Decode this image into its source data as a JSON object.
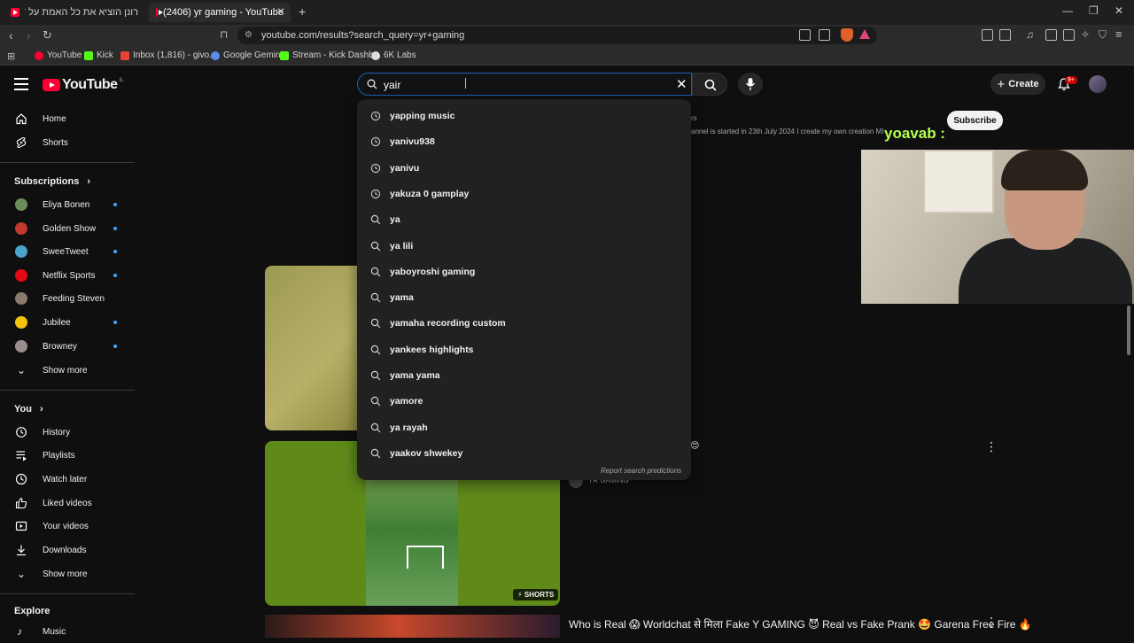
{
  "browser": {
    "tabs": [
      {
        "label": "רונן הוציא את כל האמת על דה כהן...",
        "active": false
      },
      {
        "label": "(2406) yr gaming - YouTube",
        "active": true
      }
    ],
    "url": "youtube.com/results?search_query=yr+gaming",
    "bookmarks": [
      "YouTube",
      "Kick",
      "Inbox (1,816) - givo...",
      "Google Gemini",
      "Stream - Kick Dashb...",
      "6K Labs"
    ]
  },
  "masthead": {
    "logo": "YouTube",
    "country_code": "IL",
    "search_value": "yair",
    "create_label": "Create",
    "notification_badge": "9+"
  },
  "sidebar": {
    "home": "Home",
    "shorts": "Shorts",
    "subscriptions_header": "Subscriptions",
    "subscriptions": [
      {
        "name": "Eliya Bonen",
        "color": "#6a8f5a"
      },
      {
        "name": "Golden Show",
        "color": "#c0392b"
      },
      {
        "name": "SweeTweet",
        "color": "#4aa3c8"
      },
      {
        "name": "Netflix Sports",
        "color": "#e50914"
      },
      {
        "name": "Feeding Steven",
        "color": "#8a7a6a"
      },
      {
        "name": "Jubilee",
        "color": "#f4c20d"
      },
      {
        "name": "Browney",
        "color": "#9a8f8f"
      }
    ],
    "show_more": "Show more",
    "you_header": "You",
    "you_items": [
      "History",
      "Playlists",
      "Watch later",
      "Liked videos",
      "Your videos",
      "Downloads"
    ],
    "show_more_2": "Show more",
    "explore_header": "Explore",
    "explore_items": [
      "Music"
    ]
  },
  "suggestions": [
    {
      "text": "yapping music",
      "type": "history"
    },
    {
      "text": "yanivu938",
      "type": "history"
    },
    {
      "text": "yanivu",
      "type": "history"
    },
    {
      "text": "yakuza 0 gamplay",
      "type": "history"
    },
    {
      "text": "ya",
      "type": "search"
    },
    {
      "text": "ya lili",
      "type": "search"
    },
    {
      "text": "yaboyroshi gaming",
      "type": "search"
    },
    {
      "text": "yama",
      "type": "search"
    },
    {
      "text": "yamaha recording custom",
      "type": "search"
    },
    {
      "text": "yankees highlights",
      "type": "search"
    },
    {
      "text": "yama yama",
      "type": "search"
    },
    {
      "text": "yamore",
      "type": "search"
    },
    {
      "text": "ya rayah",
      "type": "search"
    },
    {
      "text": "yaakov shwekey",
      "type": "search"
    }
  ],
  "report_predictions": "Report search predictions",
  "results": {
    "channel_desc_fragment": "annel is started in 23th July 2024 I create my own creation MI",
    "subscribers_fragment": "rs",
    "subscribe_label": "Subscribe",
    "overlay_name": "yoavab :",
    "shorts_badge": "SHORTS",
    "channel_name": "YR GAMING",
    "video_title": "Who is Real 😱 Worldchat से मिला Fake Y GAMING 😈 Real vs Fake Prank 🤩 Garena Free Fire 🔥"
  }
}
